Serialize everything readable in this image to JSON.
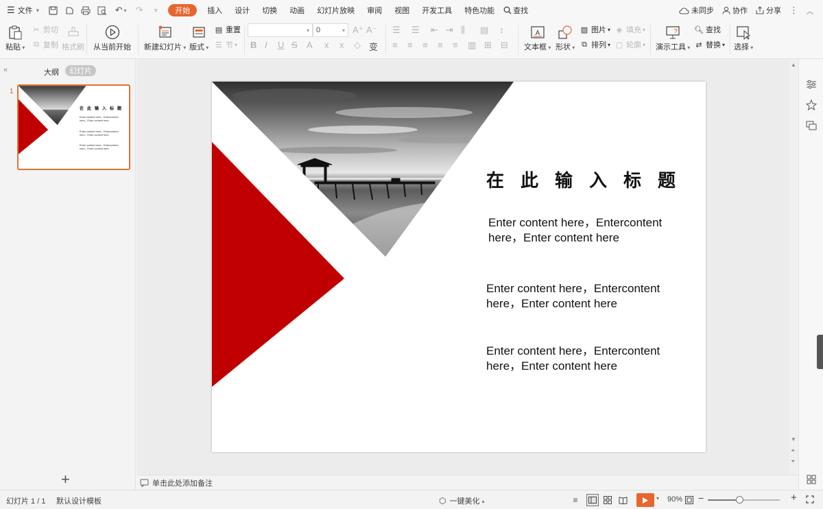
{
  "menubar": {
    "file_label": "文件",
    "tabs": [
      "开始",
      "插入",
      "设计",
      "切换",
      "动画",
      "幻灯片放映",
      "审阅",
      "视图",
      "开发工具",
      "特色功能"
    ],
    "search_label": "查找",
    "sync_label": "未同步",
    "collab_label": "协作",
    "share_label": "分享"
  },
  "ribbon": {
    "paste": "粘贴",
    "cut": "剪切",
    "copy": "复制",
    "format_painter": "格式刷",
    "from_current": "从当前开始",
    "new_slide": "新建幻灯片",
    "layout": "版式",
    "reset": "重置",
    "section": "节",
    "font_size": "0",
    "textbox": "文本框",
    "shape": "形状",
    "picture": "图片",
    "fill": "填充",
    "arrange": "排列",
    "outline": "轮廓",
    "present_tools": "演示工具",
    "find": "查找",
    "replace": "替换",
    "select": "选择"
  },
  "left_panel": {
    "tab_outline": "大纲",
    "tab_slides": "幻灯片",
    "slide_number": "1"
  },
  "slide": {
    "title": "在此输入标题",
    "para1": "Enter content here，Entercontent here，Enter content here",
    "para2": "Enter content here，Entercontent here，Enter content here",
    "para3": "Enter content here，Entercontent here，Enter content here",
    "accent_color": "#c00000"
  },
  "notes": {
    "placeholder": "单击此处添加备注"
  },
  "statusbar": {
    "slide_info": "幻灯片 1 / 1",
    "template": "默认设计模板",
    "beautify": "一键美化",
    "zoom": "90%",
    "zoom_fraction": 0.45
  },
  "colors": {
    "accent": "#e8652f",
    "slide_red": "#c00000"
  }
}
